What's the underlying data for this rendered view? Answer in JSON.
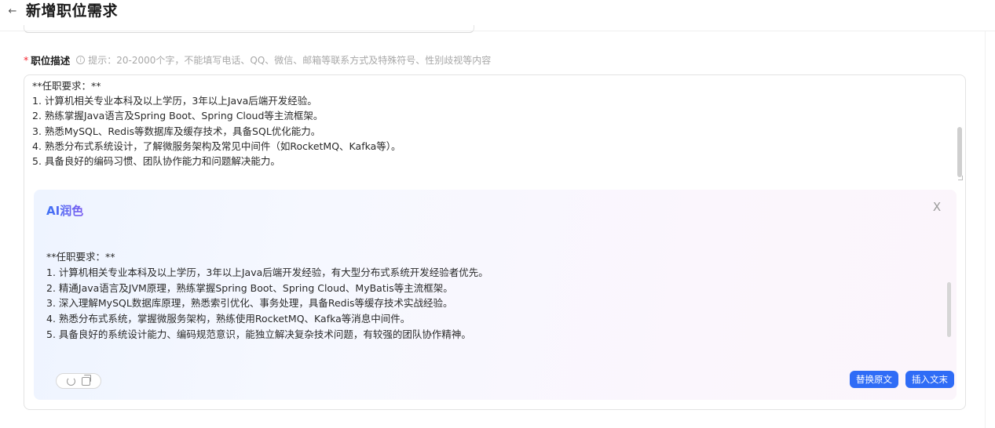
{
  "header": {
    "back_icon": "arrow-left-icon",
    "back_glyph": "←",
    "title": "新增职位需求"
  },
  "field": {
    "required_mark": "*",
    "label": "职位描述",
    "info_icon": "info-icon",
    "info_glyph": "i",
    "hint": "提示：20-2000个字，不能填写电话、QQ、微信、邮箱等联系方式及特殊符号、性别歧视等内容"
  },
  "description": {
    "lines": [
      "**任职要求：**",
      "1. 计算机相关专业本科及以上学历，3年以上Java后端开发经验。",
      "2. 熟练掌握Java语言及Spring Boot、Spring Cloud等主流框架。",
      "3. 熟悉MySQL、Redis等数据库及缓存技术，具备SQL优化能力。",
      "4. 熟悉分布式系统设计，了解微服务架构及常见中间件（如RocketMQ、Kafka等）。",
      "5. 具备良好的编码习惯、团队协作能力和问题解决能力。"
    ]
  },
  "ai_panel": {
    "title": "AI润色",
    "close_icon": "close-icon",
    "close_glyph": "X",
    "lines": [
      "**任职要求：**",
      "1. 计算机相关专业本科及以上学历，3年以上Java后端开发经验，有大型分布式系统开发经验者优先。",
      "2. 精通Java语言及JVM原理，熟练掌握Spring Boot、Spring Cloud、MyBatis等主流框架。",
      "3. 深入理解MySQL数据库原理，熟悉索引优化、事务处理，具备Redis等缓存技术实战经验。",
      "4. 熟悉分布式系统，掌握微服务架构，熟练使用RocketMQ、Kafka等消息中间件。",
      "5. 具备良好的系统设计能力、编码规范意识，能独立解决复杂技术问题，有较强的团队协作精神。"
    ],
    "tools": {
      "regenerate_icon": "refresh-icon",
      "copy_icon": "copy-icon"
    },
    "replace_button": "替换原文",
    "insert_button": "插入文末"
  },
  "colors": {
    "primary": "#2f6cf6",
    "required": "#f5222d",
    "hint": "#a8a8a8"
  }
}
